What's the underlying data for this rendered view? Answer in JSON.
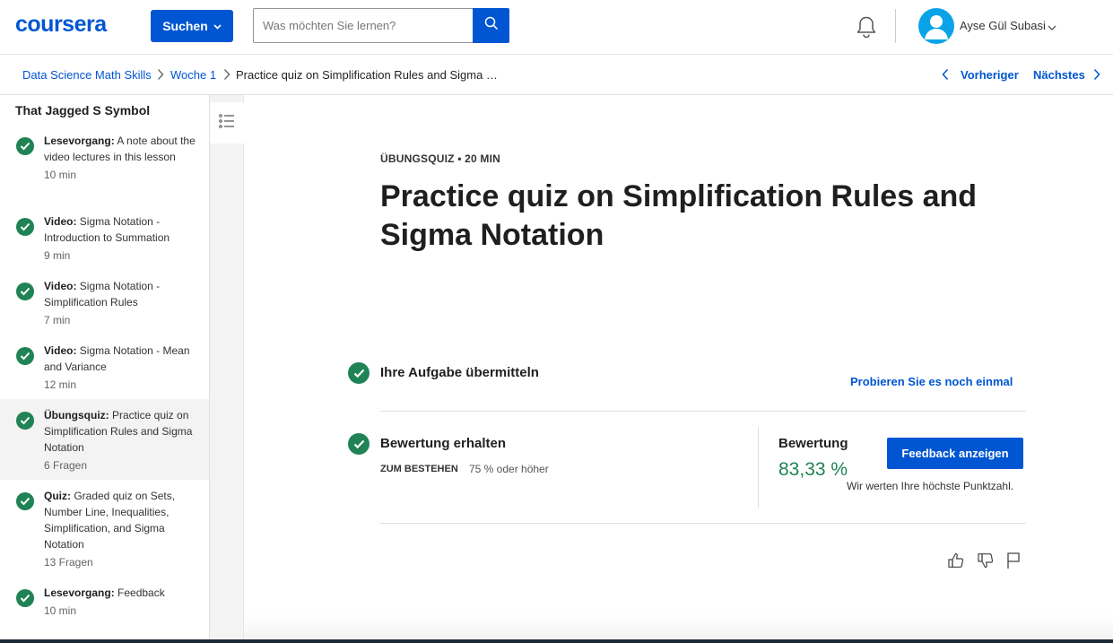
{
  "header": {
    "logo": "coursera",
    "explore_label": "Suchen",
    "search_placeholder": "Was möchten Sie lernen?",
    "user_name": "Ayse Gül Subasi"
  },
  "breadcrumb": {
    "items": [
      "Data Science Math Skills",
      "Woche 1",
      "Practice quiz on Simplification Rules and Sigma …"
    ],
    "prev_label": "Vorheriger",
    "next_label": "Nächstes"
  },
  "sidebar": {
    "title": "That Jagged S Symbol",
    "items": [
      {
        "kind": "Lesevorgang:",
        "text": " A note about the video lectures in this lesson",
        "meta": "10 min",
        "active": false
      },
      {
        "kind": "Video:",
        "text": " Sigma Notation - Introduction to Summation",
        "meta": "9 min",
        "active": false
      },
      {
        "kind": "Video:",
        "text": " Sigma Notation - Simplification Rules",
        "meta": "7 min",
        "active": false
      },
      {
        "kind": "Video:",
        "text": " Sigma Notation - Mean and Variance",
        "meta": "12 min",
        "active": false
      },
      {
        "kind": "Übungsquiz:",
        "text": " Practice quiz on Simplification Rules and Sigma Notation",
        "meta": "6 Fragen",
        "active": true
      },
      {
        "kind": "Quiz:",
        "text": " Graded quiz on Sets, Number Line, Inequalities, Simplification, and Sigma Notation",
        "meta": "13 Fragen",
        "active": false
      },
      {
        "kind": "Lesevorgang:",
        "text": " Feedback",
        "meta": "10 min",
        "active": false
      }
    ]
  },
  "main": {
    "eyebrow": "ÜBUNGSQUIZ • 20 MIN",
    "title": "Practice quiz on Simplification Rules and Sigma Notation",
    "step1_label": "Ihre Aufgabe übermitteln",
    "retry_label": "Probieren Sie es noch einmal",
    "step2_label": "Bewertung erhalten",
    "pass_label": "ZUM BESTEHEN",
    "pass_value": "75 % oder höher",
    "grade_label": "Bewertung",
    "grade_value": "83,33 %",
    "feedback_button": "Feedback anzeigen",
    "grade_note": "Wir werten Ihre höchste Punktzahl."
  },
  "colors": {
    "brand": "#0056d2",
    "success": "#1f8354"
  }
}
